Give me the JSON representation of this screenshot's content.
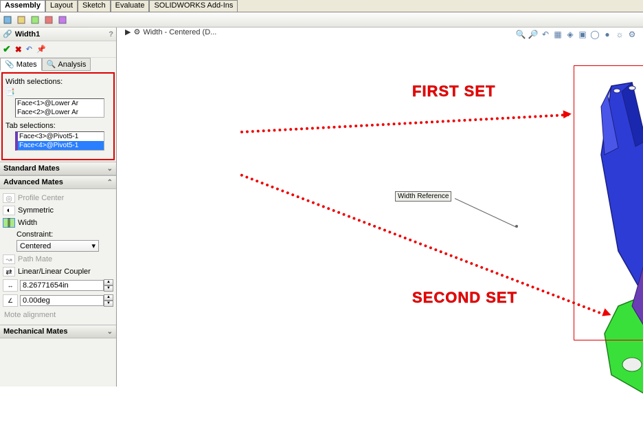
{
  "menubar": {
    "tabs": [
      "Assembly",
      "Layout",
      "Sketch",
      "Evaluate",
      "SOLIDWORKS Add-Ins"
    ],
    "active": 0
  },
  "feature": {
    "name": "Width1",
    "question": "?"
  },
  "tabs": {
    "mates": "Mates",
    "analysis": "Analysis"
  },
  "selections": {
    "width_label": "Width selections:",
    "width_items": [
      "Face<1>@Lower Ar",
      "Face<2>@Lower Ar"
    ],
    "tab_label": "Tab selections:",
    "tab_items": [
      "Face<3>@Pivot5-1",
      "Face<4>@Pivot5-1"
    ]
  },
  "sections": {
    "standard": "Standard Mates",
    "advanced": "Advanced Mates",
    "mechanical": "Mechanical Mates"
  },
  "advanced": {
    "profile_center": "Profile Center",
    "symmetric": "Symmetric",
    "width": "Width",
    "constraint_label": "Constraint:",
    "constraint_value": "Centered",
    "path_mate": "Path Mate",
    "coupler": "Linear/Linear Coupler",
    "dist_value": "8.26771654in",
    "angle_value": "0.00deg",
    "alignment": "Mote alignment"
  },
  "viewport": {
    "doc_title": "Width - Centered (D...",
    "callout": "Width Reference"
  },
  "annotations": {
    "first_set": "FIRST SET",
    "second_set": "SECOND SET"
  }
}
